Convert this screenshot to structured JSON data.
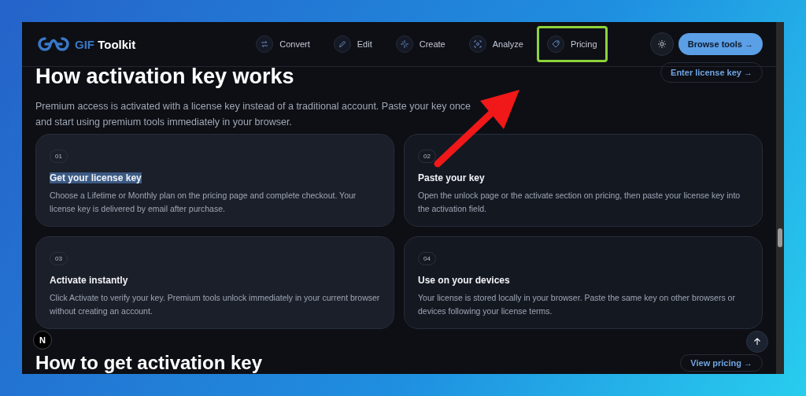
{
  "brand": {
    "accent": "GIF",
    "name": "Toolkit"
  },
  "nav": [
    {
      "label": "Convert",
      "highlighted": false
    },
    {
      "label": "Edit",
      "highlighted": false
    },
    {
      "label": "Create",
      "highlighted": false
    },
    {
      "label": "Analyze",
      "highlighted": false
    },
    {
      "label": "Pricing",
      "highlighted": true
    }
  ],
  "browse_button": {
    "label": "Browse tools",
    "arrow": "→"
  },
  "section": {
    "title": "How activation key works",
    "link": {
      "label": "Enter license key",
      "arrow": "→"
    },
    "intro": "Premium access is activated with a license key instead of a traditional account. Paste your key once and start using premium tools immediately in your browser.",
    "steps": [
      {
        "number": "01",
        "title": "Get your license key",
        "title_selected": true,
        "text": "Choose a Lifetime or Monthly plan on the pricing page and complete checkout. Your license key is delivered by email after purchase."
      },
      {
        "number": "02",
        "title": "Paste your key",
        "title_selected": false,
        "text": "Open the unlock page or the activate section on pricing, then paste your license key into the activation field."
      },
      {
        "number": "03",
        "title": "Activate instantly",
        "title_selected": false,
        "text": "Click Activate to verify your key. Premium tools unlock immediately in your current browser without creating an account."
      },
      {
        "number": "04",
        "title": "Use on your devices",
        "title_selected": false,
        "text": "Your license is stored locally in your browser. Paste the same key on other browsers or devices following your license terms."
      }
    ]
  },
  "next_section": {
    "title": "How to get activation key",
    "link": {
      "label": "View pricing",
      "arrow": "→"
    }
  },
  "dev_badge": "N"
}
